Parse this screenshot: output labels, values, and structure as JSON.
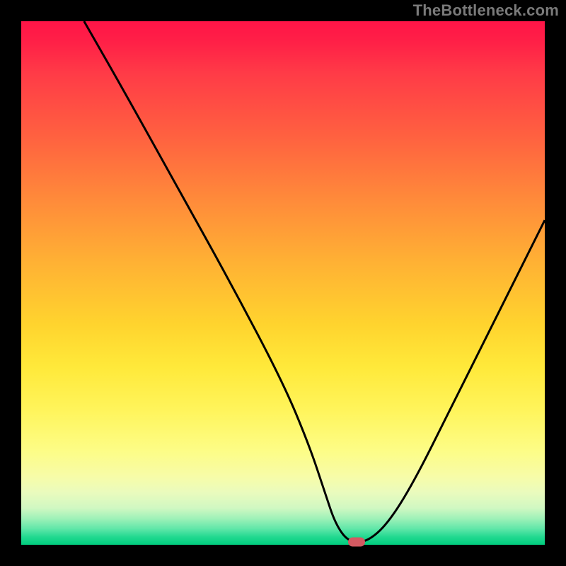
{
  "watermark": "TheBottleneck.com",
  "chart_data": {
    "type": "line",
    "title": "",
    "xlabel": "",
    "ylabel": "",
    "xlim": [
      0,
      100
    ],
    "ylim": [
      0,
      100
    ],
    "grid": false,
    "legend": false,
    "background_gradient": [
      "#ff1447",
      "#ff6140",
      "#ffd42e",
      "#fdfd86",
      "#00ce7e"
    ],
    "series": [
      {
        "name": "curve",
        "color": "#000000",
        "x": [
          12,
          20,
          30,
          40,
          50,
          55,
          58,
          60,
          62.5,
          66,
          70,
          75,
          82,
          90,
          100
        ],
        "values": [
          100,
          86,
          68,
          50,
          31,
          19,
          10,
          4,
          0.5,
          0.5,
          4,
          12,
          26,
          42,
          62
        ]
      }
    ],
    "marker": {
      "x": 64,
      "y": 0.5,
      "color": "#d45a62"
    }
  }
}
